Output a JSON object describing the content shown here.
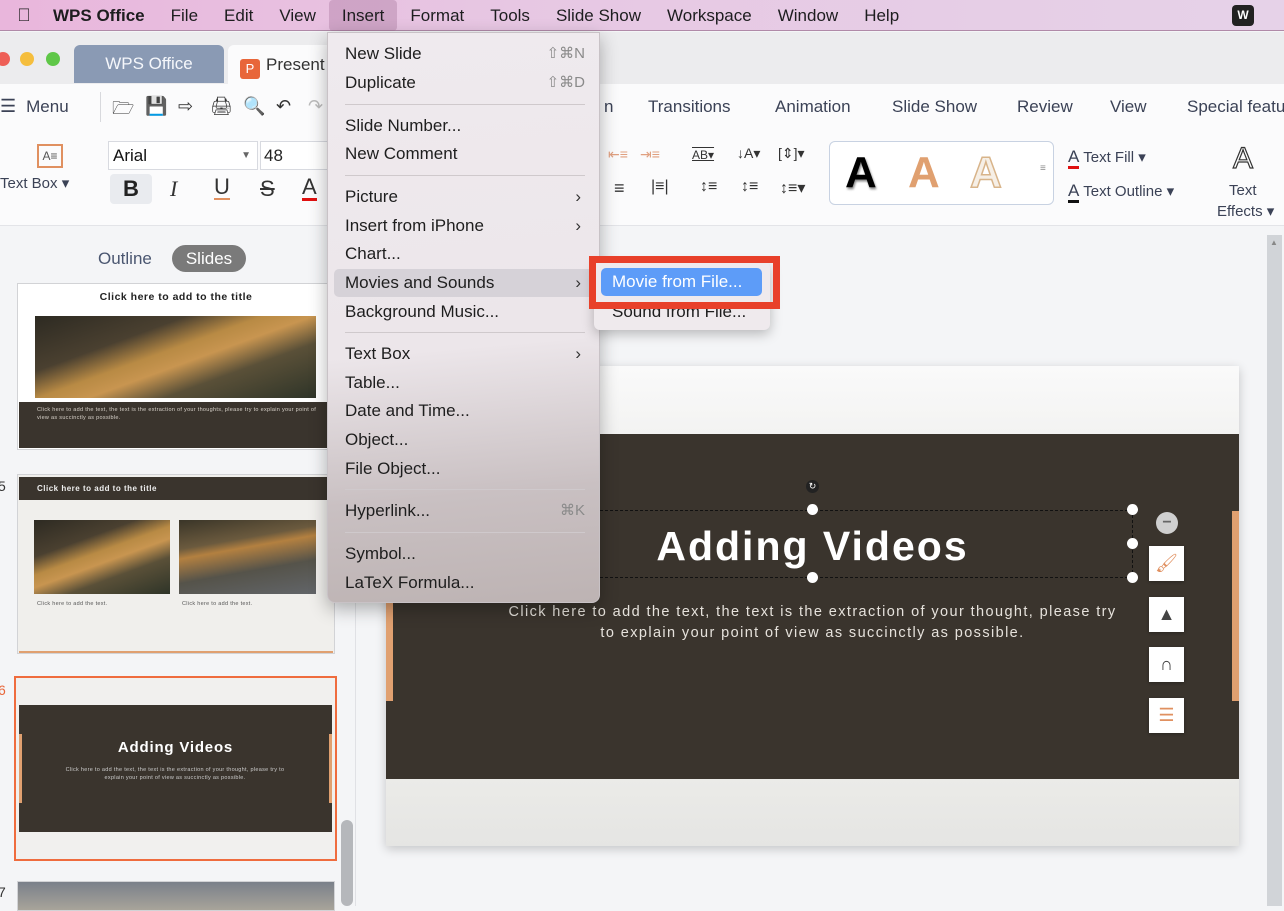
{
  "mac_menubar": {
    "app_name": "WPS Office",
    "items": [
      "File",
      "Edit",
      "View",
      "Insert",
      "Format",
      "Tools",
      "Slide Show",
      "Workspace",
      "Window",
      "Help"
    ],
    "active_item": "Insert"
  },
  "window_tabs": {
    "home_tab": "WPS Office",
    "doc_tab": "Present",
    "doc_icon_letter": "P"
  },
  "ribbon": {
    "menu_label": "Menu",
    "tabs": [
      "n",
      "Transitions",
      "Animation",
      "Slide Show",
      "Review",
      "View",
      "Special featu"
    ],
    "font_name": "Arial",
    "font_size": "48",
    "text_box_label": "Text Box ▾",
    "format_buttons": {
      "bold": "B",
      "italic": "I",
      "underline": "U",
      "strike": "S",
      "color": "A"
    },
    "style_glyph": "A",
    "text_fill_label": "Text Fill ▾",
    "text_outline_label": "Text Outline ▾",
    "text_effects_line1": "Text",
    "text_effects_line2": "Effects ▾",
    "accent_color": "#e09060"
  },
  "left_panel": {
    "outline_tab": "Outline",
    "slides_tab": "Slides",
    "thumbs": [
      {
        "number": "",
        "title": "Click here to add to the title",
        "body": "Click here to add the text, the text is the extraction of your thoughts, please try to explain your point of view as succinctly as possible."
      },
      {
        "number": "5",
        "title": "Click here to add to the title",
        "caption_left": "Click here to add the text.",
        "caption_right": "Click here to add the text."
      },
      {
        "number": "6",
        "title": "Adding Videos",
        "body": "Click here to add the text, the text is the extraction of your thought, please try to explain your point of view as succinctly as possible."
      },
      {
        "number": "7"
      }
    ]
  },
  "slide": {
    "title": "Adding Videos",
    "body": "Click here to add the text, the text is the extraction of your thought, please try to explain your point of view as succinctly as possible.",
    "dark_color": "#3a342d",
    "accent_color": "#e0a070"
  },
  "insert_menu": {
    "items": [
      {
        "label": "New Slide",
        "shortcut": "⇧⌘N"
      },
      {
        "label": "Duplicate",
        "shortcut": "⇧⌘D"
      },
      {
        "label": "Slide Number..."
      },
      {
        "label": "New Comment"
      },
      {
        "label": "Picture",
        "submenu": true
      },
      {
        "label": "Insert from iPhone",
        "submenu": true
      },
      {
        "label": "Chart..."
      },
      {
        "label": "Movies and Sounds",
        "submenu": true,
        "highlighted": true
      },
      {
        "label": "Background Music..."
      },
      {
        "label": "Text Box",
        "submenu": true
      },
      {
        "label": "Table..."
      },
      {
        "label": "Date and Time..."
      },
      {
        "label": "Object..."
      },
      {
        "label": "File Object..."
      },
      {
        "label": "Hyperlink...",
        "shortcut": "⌘K"
      },
      {
        "label": "Symbol..."
      },
      {
        "label": "LaTeX Formula..."
      }
    ]
  },
  "submenu": {
    "items": [
      "Movie from File...",
      "Sound from File..."
    ],
    "selected": "Movie from File...",
    "highlight_color": "#5d9cf8",
    "callout_color": "#e8402a"
  }
}
